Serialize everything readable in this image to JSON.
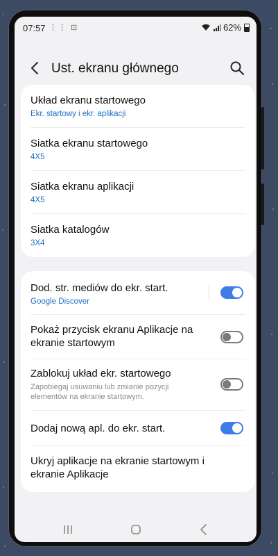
{
  "status_bar": {
    "time": "07:57",
    "battery": "62%",
    "notif_icons": "⋮⋮ ⊡"
  },
  "header": {
    "title": "Ust. ekranu głównego"
  },
  "grid_section": [
    {
      "title": "Układ ekranu startowego",
      "value": "Ekr. startowy i ekr. aplikacji"
    },
    {
      "title": "Siatka ekranu startowego",
      "value": "4X5"
    },
    {
      "title": "Siatka ekranu aplikacji",
      "value": "4X5"
    },
    {
      "title": "Siatka katalogów",
      "value": "3X4"
    }
  ],
  "options_section": [
    {
      "title": "Dod. str. mediów do ekr. start.",
      "sub": "Google Discover",
      "toggle": "on"
    },
    {
      "title": "Pokaż przycisk ekranu Aplikacje na ekranie startowym",
      "toggle": "off"
    },
    {
      "title": "Zablokuj układ ekr. startowego",
      "desc": "Zapobiegaj usuwaniu lub zmianie pozycji elementów na ekranie startowym.",
      "toggle": "off"
    },
    {
      "title": "Dodaj nową apl. do ekr. start.",
      "toggle": "on"
    },
    {
      "title": "Ukryj aplikacje na ekranie startowym i ekranie Aplikacje"
    }
  ],
  "colors": {
    "accent": "#3e7de8",
    "link": "#1f6fc5",
    "background": "#f2f2f4"
  },
  "icons": {
    "back": "chevron-left-icon",
    "search": "search-icon",
    "nav_recent": "recent-apps-icon",
    "nav_home": "home-icon",
    "nav_back": "back-arrow-icon"
  }
}
